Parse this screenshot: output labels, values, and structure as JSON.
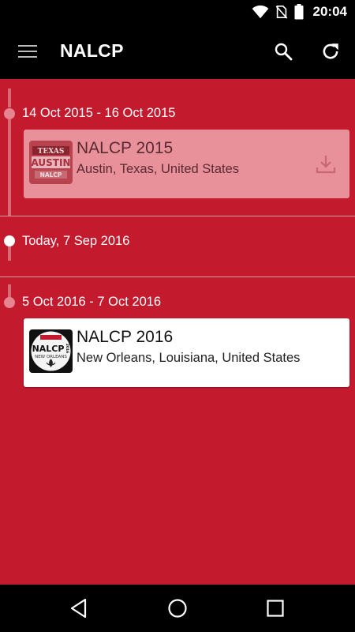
{
  "status_bar": {
    "time": "20:04",
    "icons": [
      "wifi-icon",
      "no-sim-icon",
      "battery-icon"
    ]
  },
  "app_bar": {
    "title": "NALCP",
    "icons": [
      "menu-icon",
      "search-icon",
      "refresh-icon"
    ]
  },
  "timeline": [
    {
      "type": "event",
      "date_label": "14 Oct 2015 - 16 Oct 2015",
      "name": "NALCP 2015",
      "location": "Austin, Texas, United States",
      "logo": {
        "top": "TEXAS",
        "middle": "AUSTIN",
        "bottom": "NALCP"
      },
      "status": "past"
    },
    {
      "type": "today",
      "date_label": "Today, 7 Sep 2016"
    },
    {
      "type": "event",
      "date_label": "5 Oct 2016 - 7 Oct 2016",
      "name": "NALCP 2016",
      "location": "New Orleans, Louisiana, United States",
      "logo": {
        "main": "NALCP",
        "side": "2016",
        "sub": "NEW ORLEANS"
      },
      "status": "upcoming"
    }
  ],
  "colors": {
    "background": "#c41a2e",
    "past_card": "#e8919b",
    "bars": "#000000"
  },
  "nav_bar": {
    "icons": [
      "back-icon",
      "home-icon",
      "recents-icon"
    ]
  }
}
